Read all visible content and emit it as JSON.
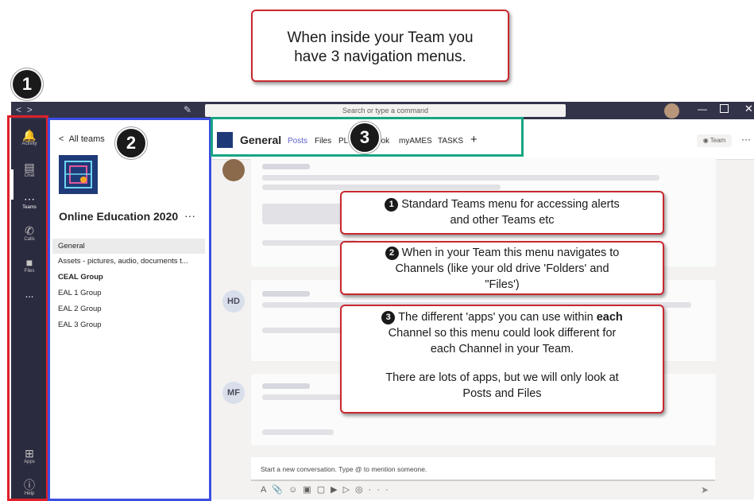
{
  "top_callout": {
    "line1": "When inside your Team you",
    "line2": "have 3 navigation menus."
  },
  "markers": {
    "one": "1",
    "two": "2",
    "three": "3"
  },
  "titlebar": {
    "search_placeholder": "Search or type a command",
    "nav_back": "<",
    "nav_forward": ">"
  },
  "rail": {
    "items": [
      {
        "label": "Activity",
        "icon": "bell-icon"
      },
      {
        "label": "Chat",
        "icon": "chat-icon"
      },
      {
        "label": "Teams",
        "icon": "teams-icon"
      },
      {
        "label": "Calls",
        "icon": "phone-icon"
      },
      {
        "label": "Files",
        "icon": "file-icon"
      },
      {
        "label": "...",
        "icon": "more-icon"
      }
    ],
    "bottom": [
      {
        "label": "Apps",
        "icon": "apps-icon"
      },
      {
        "label": "Help",
        "icon": "help-icon"
      }
    ]
  },
  "channels_panel": {
    "back_label": "All teams",
    "team_name": "Online Education 2020",
    "more": "···",
    "channels": [
      {
        "name": "General",
        "selected": true,
        "bold": false
      },
      {
        "name": "Assets - pictures, audio, documents t...",
        "selected": false,
        "bold": false
      },
      {
        "name": "CEAL Group",
        "selected": false,
        "bold": true
      },
      {
        "name": "EAL 1 Group",
        "selected": false,
        "bold": false
      },
      {
        "name": "EAL 2 Group",
        "selected": false,
        "bold": false
      },
      {
        "name": "EAL 3 Group",
        "selected": false,
        "bold": false
      }
    ]
  },
  "channel_header": {
    "title": "General",
    "tabs": [
      "Posts",
      "Files",
      "PL",
      "ook",
      "myAMES",
      "TASKS"
    ],
    "add_tab": "+",
    "team_button": "Team",
    "more": "···"
  },
  "posts": [
    {
      "avatar_initials": ""
    },
    {
      "avatar_initials": "HD"
    },
    {
      "avatar_initials": "MF"
    }
  ],
  "compose": {
    "placeholder": "Start a new conversation. Type @ to mention someone.",
    "more": "···"
  },
  "callouts": {
    "one": {
      "number": "1",
      "line1": "Standard Teams menu for accessing alerts",
      "line2": "and other Teams etc"
    },
    "two": {
      "number": "2",
      "line1": "When in your Team this menu navigates to",
      "line2": "Channels (like your old drive  'Folders' and",
      "line3": "\"Files')"
    },
    "three": {
      "number": "3",
      "line1_pre": "The different 'apps' you can use within ",
      "line1_bold": "each",
      "line2": "Channel so this menu could look different for",
      "line3": "each Channel in your Team.",
      "line4": "There are lots of apps, but we will only look at",
      "line5": "Posts and Files"
    }
  },
  "colors": {
    "rail": "#2b2b40",
    "titlebar": "#33344a",
    "accent": "#5b5fc7",
    "red_box": "#e0202a",
    "blue_box": "#3a4fe0",
    "green_box": "#17a583"
  }
}
